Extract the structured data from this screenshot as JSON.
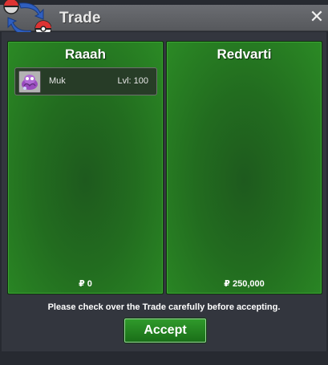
{
  "window": {
    "title": "Trade",
    "close_label": "✕",
    "logo_icon": "pokeball-swap-icon"
  },
  "panels": [
    {
      "player": "Raaah",
      "items": [
        {
          "name": "Muk",
          "level": "Lvl: 100",
          "icon": "pokemon-muk-icon"
        }
      ],
      "money": "₽ 0"
    },
    {
      "player": "Redvarti",
      "items": [],
      "money": "₽ 250,000"
    }
  ],
  "notice": "Please check over the Trade carefully before accepting.",
  "accept_label": "Accept",
  "colors": {
    "panel_green": "#226c1f",
    "accept_green": "#2f9a2b",
    "titlebar_gray": "#6b6d72",
    "background": "#33363e"
  }
}
